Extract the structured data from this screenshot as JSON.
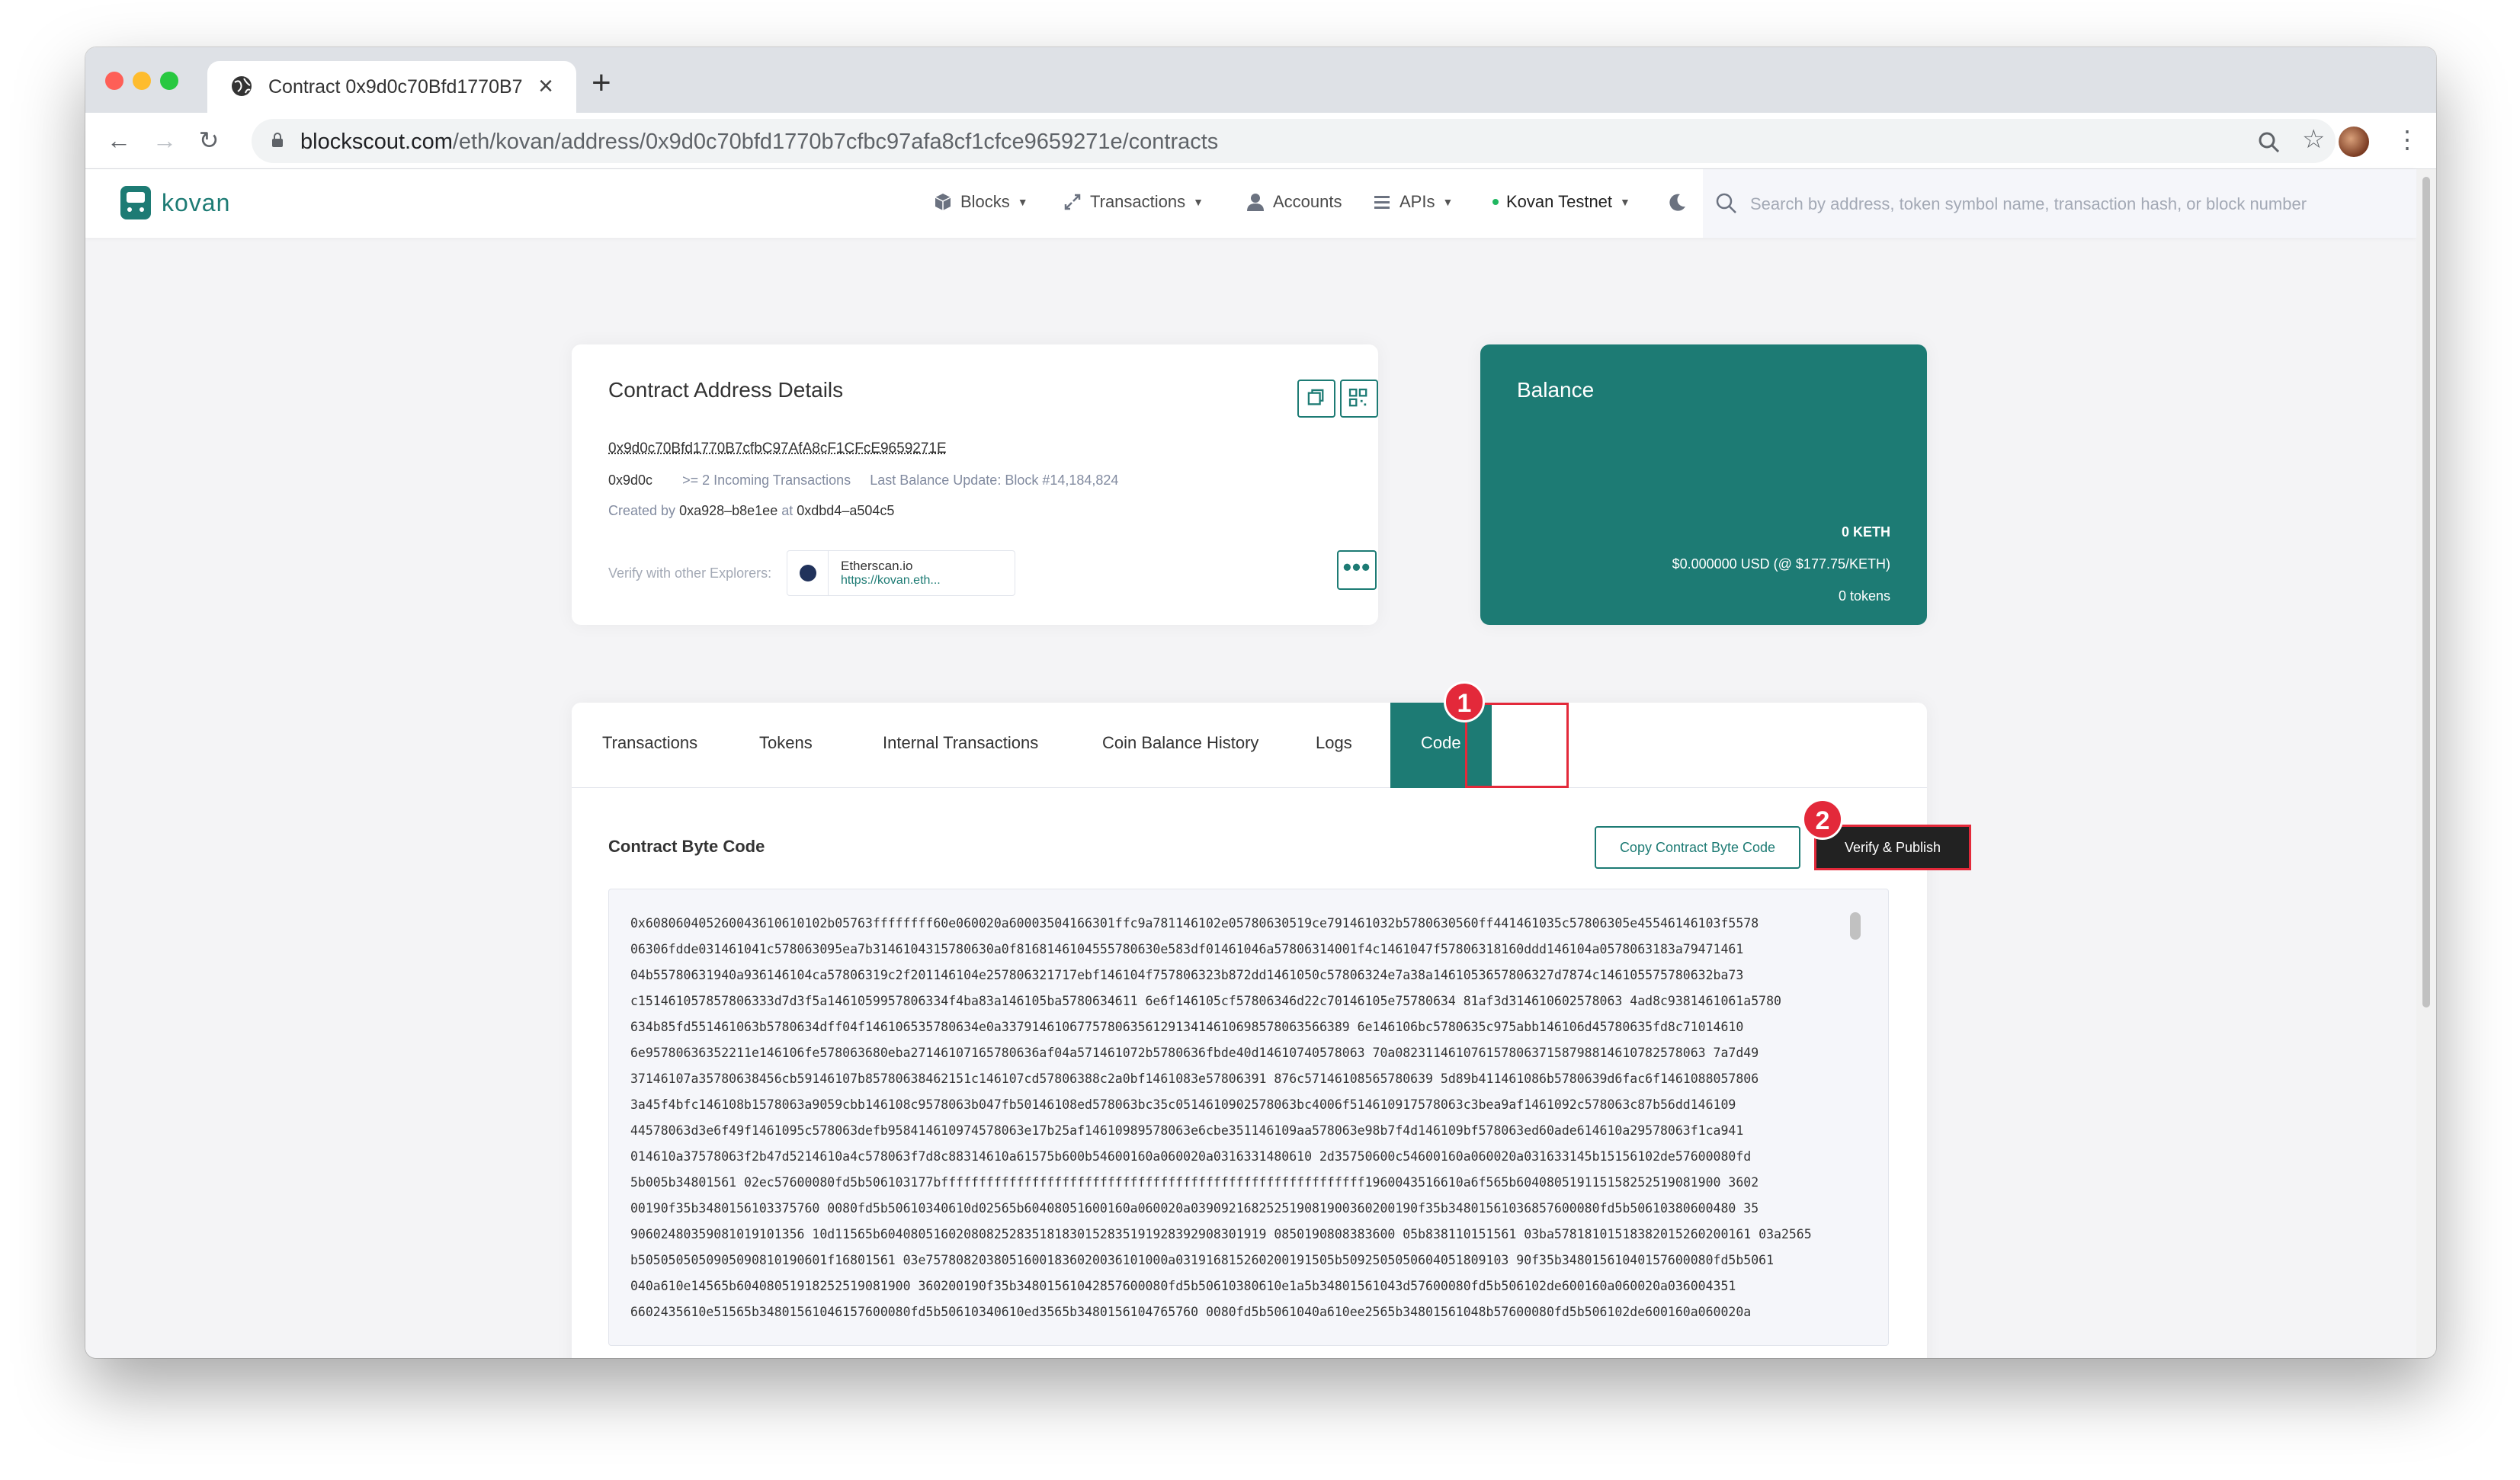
{
  "browser": {
    "tab_title": "Contract 0x9d0c70Bfd1770B7",
    "url_domain": "blockscout.com",
    "url_path": "/eth/kovan/address/0x9d0c70bfd1770b7cfbc97afa8cf1cfce9659271e/contracts"
  },
  "site": {
    "brand": "kovan",
    "nav": {
      "blocks": "Blocks",
      "transactions": "Transactions",
      "accounts": "Accounts",
      "apis": "APIs",
      "network": "Kovan Testnet"
    },
    "search_placeholder": "Search by address, token symbol name, transaction hash, or block number"
  },
  "details": {
    "title": "Contract Address Details",
    "address": "0x9d0c70Bfd1770B7cfbC97AfA8cF1CFcE9659271E",
    "short_addr": "0x9d0c",
    "incoming": ">= 2 Incoming Transactions",
    "last_balance": "Last Balance Update: Block #14,184,824",
    "created_prefix": "Created by",
    "creator": "0xa928–b8e1ee",
    "at": "at",
    "creation_tx": "0xdbd4–a504c5",
    "verify_label": "Verify with other Explorers:",
    "explorer_name": "Etherscan.io",
    "explorer_link": "https://kovan.eth..."
  },
  "balance": {
    "title": "Balance",
    "keth": "0 KETH",
    "usd": "$0.000000 USD (@ $177.75/KETH)",
    "tokens": "0 tokens"
  },
  "tabs": {
    "transactions": "Transactions",
    "tokens": "Tokens",
    "internal": "Internal Transactions",
    "coin_history": "Coin Balance History",
    "logs": "Logs",
    "code": "Code"
  },
  "code_section": {
    "title": "Contract Byte Code",
    "copy_button": "Copy Contract Byte Code",
    "verify_button": "Verify & Publish",
    "bytecode_lines": [
      "0x608060405260043610610102b05763ffffffff60e060020a60003504166301ffc9a781146102e05780630519ce791461032b5780630560ff441461035c57806305e45546146103f5578",
      "06306fdde031461041c578063095ea7b3146104315780630a0f8168146104555780630e583df01461046a57806314001f4c1461047f57806318160ddd146104a0578063183a79471461",
      "04b55780631940a936146104ca57806319c2f201146104e257806321717ebf146104f757806323b872dd1461050c57806324e7a38a1461053657806327d7874c146105575780632ba73",
      "c151461057857806333d7d3f5a1461059957806334f4ba83a146105ba5780634611 6e6f146105cf57806346d22c70146105e75780634 81af3d314610602578063 4ad8c9381461061a5780",
      "634b85fd551461063b5780634dff04f146106535780634e0a3379146106775780635612913414610698578063566389 6e146106bc5780635c975abb146106d45780635fd8c71014610",
      "6e95780636352211e146106fe578063680eba27146107165780636af04a571461072b5780636fbde40d14610740578063 70a08231146107615780637158798814610782578063 7a7d49",
      "37146107a35780638456cb59146107b85780638462151c146107cd57806388c2a0bf1461083e57806391 876c57146108565780639 5d89b411461086b5780639d6fac6f1461088057806",
      "3a45f4bfc146108b1578063a9059cbb146108c9578063b047fb50146108ed578063bc35c0514610902578063bc4006f514610917578063c3bea9af1461092c578063c87b56dd146109",
      "44578063d3e6f49f1461095c578063defb958414610974578063e17b25af14610989578063e6cbe351146109aa578063e98b7f4d146109bf578063ed60ade614610a29578063f1ca941",
      "014610a37578063f2b47d5214610a4c578063f7d8c88314610a61575b600b54600160a060020a0316331480610 2d35750600c54600160a060020a031633145b15156102de57600080fd",
      "5b005b34801561 02ec57600080fd5b506103177bffffffffffffffffffffffffffffffffffffffffffffffffffffffff1960043516610a6f565b604080519115158252519081900 3602",
      "00190f35b3480156103375760 0080fd5b50610340610d02565b60408051600160a060020a039092168252519081900360200190f35b34801561036857600080fd5b50610380600480 35",
      "90602480359081019101356 10d11565b604080516020808252835181830152835191928392908301919 0850190808383600 05b838110151561 03ba57818101518382015260200161 03a2565",
      "b5050505050905090810190601f16801561 03e75780820380516001836020036101000a031916815260200191505b5092505050604051809103 90f35b34801561040157600080fd5b5061",
      "040a610e14565b60408051918252519081900 360200190f35b34801561042857600080fd5b50610380610e1a5b34801561043d57600080fd5b506102de600160a060020a036004351",
      "6602435610e51565b34801561046157600080fd5b50610340610ed3565b3480156104765760 0080fd5b5061040a610ee2565b34801561048b57600080fd5b506102de600160a060020a"
    ]
  }
}
